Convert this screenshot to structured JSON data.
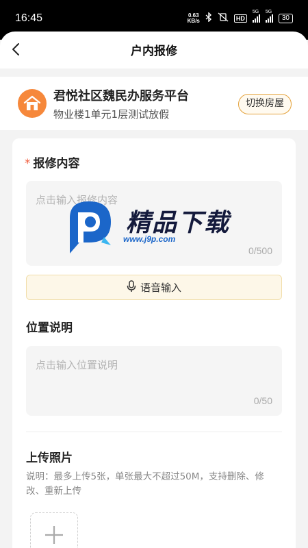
{
  "status_bar": {
    "time": "16:45",
    "net_speed_value": "0.63",
    "net_speed_unit": "KB/s",
    "hd_label": "HD",
    "signal1_label": "5G",
    "signal2_label": "5G",
    "battery": "30",
    "icons": [
      "bluetooth-icon",
      "vibrate-off-icon",
      "signal-icon",
      "battery-icon"
    ]
  },
  "header": {
    "title": "户内报修",
    "back_icon": "chevron-left-icon"
  },
  "community": {
    "icon": "home-icon",
    "name": "君悦社区魏民办服务平台",
    "address": "物业楼1单元1层测试放假",
    "switch_label": "切换房屋"
  },
  "form": {
    "content": {
      "required_mark": "*",
      "label": "报修内容",
      "placeholder": "点击输入报修内容",
      "counter": "0/500"
    },
    "voice": {
      "icon": "microphone-icon",
      "label": "语音输入"
    },
    "location": {
      "label": "位置说明",
      "placeholder": "点击输入位置说明",
      "counter": "0/50"
    },
    "photos": {
      "label": "上传照片",
      "description": "说明：最多上传5张，单张最大不超过50M，支持删除、修改、重新上传",
      "add_icon": "plus-icon"
    }
  },
  "watermark": {
    "name": "精品下载",
    "url": "www.j9p.com"
  },
  "colors": {
    "accent_orange": "#f6883b",
    "required_red": "#f05a3a",
    "switch_border": "#e3a13a",
    "voice_bg": "#fdf7e8",
    "watermark_blue": "#1b66c9"
  }
}
